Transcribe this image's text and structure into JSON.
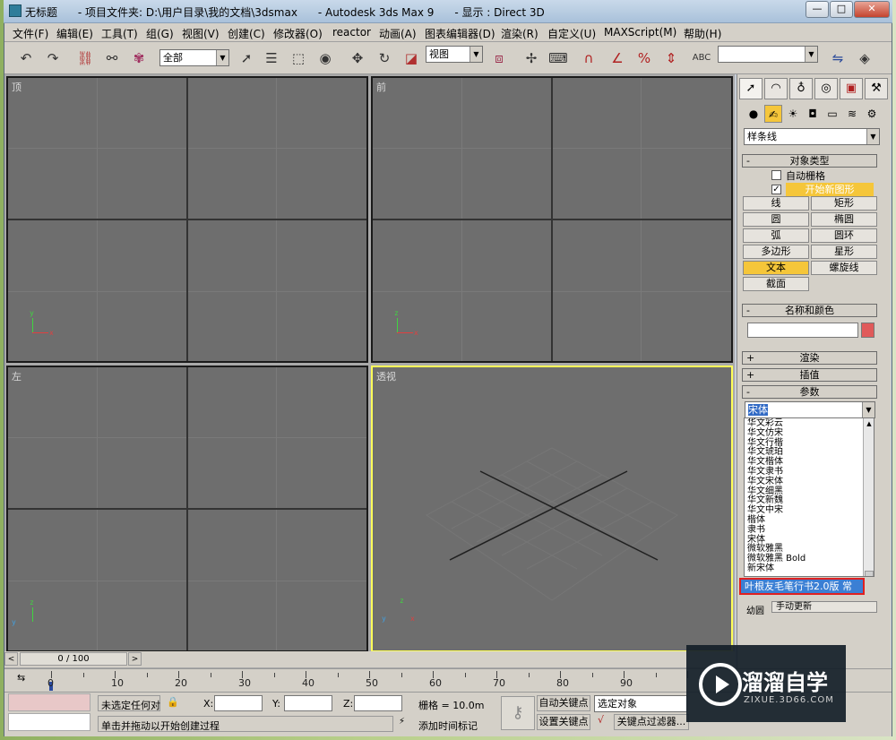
{
  "window": {
    "title": "无标题      - 项目文件夹: D:\\用户目录\\我的文档\\3dsmax      - Autodesk 3ds Max 9      - 显示 : Direct 3D",
    "controls": [
      "—",
      "□",
      "✕"
    ]
  },
  "menu": [
    "文件(F)",
    "编辑(E)",
    "工具(T)",
    "组(G)",
    "视图(V)",
    "创建(C)",
    "修改器(O)",
    "reactor",
    "动画(A)",
    "图表编辑器(D)",
    "渲染(R)",
    "自定义(U)",
    "MAXScript(M)",
    "帮助(H)"
  ],
  "toolbar": {
    "selection_filter": "全部",
    "ref_coord": "视图",
    "named_sel": ""
  },
  "viewports": [
    {
      "label": "顶"
    },
    {
      "label": "前"
    },
    {
      "label": "左"
    },
    {
      "label": "透视"
    }
  ],
  "axes": {
    "x": "x",
    "y": "y",
    "z": "z"
  },
  "command_panel": {
    "category": "样条线",
    "object_type": {
      "header": "对象类型",
      "auto_grid": "自动栅格",
      "start_new_shape": "开始新图形",
      "buttons": [
        {
          "label": "线"
        },
        {
          "label": "矩形"
        },
        {
          "label": "圆"
        },
        {
          "label": "椭圆"
        },
        {
          "label": "弧"
        },
        {
          "label": "圆环"
        },
        {
          "label": "多边形"
        },
        {
          "label": "星形"
        },
        {
          "label": "文本",
          "active": true
        },
        {
          "label": "螺旋线"
        },
        {
          "label": "截面"
        }
      ]
    },
    "name_color": {
      "header": "名称和颜色",
      "color": "#e05a5a"
    },
    "rollouts": [
      {
        "sign": "+",
        "label": "渲染"
      },
      {
        "sign": "+",
        "label": "插值"
      },
      {
        "sign": "-",
        "label": "参数"
      }
    ],
    "font_selected": "宋体",
    "font_list": [
      "华文彩云",
      "华文仿宋",
      "华文行楷",
      "华文琥珀",
      "华文楷体",
      "华文隶书",
      "华文宋体",
      "华文细黑",
      "华文新魏",
      "华文中宋",
      "楷体",
      "隶书",
      "宋体",
      "微软雅黑",
      "微软雅黑 Bold",
      "新宋体"
    ],
    "highlighted_font": "叶根友毛笔行书2.0版 常",
    "below_item": "幼圆",
    "manual_update": "手动更新"
  },
  "timeline": {
    "frame_counter": "0 / 100",
    "ticks": [
      "0",
      "10",
      "20",
      "30",
      "40",
      "50",
      "60",
      "70",
      "80",
      "90"
    ]
  },
  "status": {
    "selection": "未选定任何对",
    "x_label": "X:",
    "y_label": "Y:",
    "z_label": "Z:",
    "grid": "栅格 = 10.0m",
    "prompt": "单击并拖动以开始创建过程",
    "add_time_tag": "添加时间标记",
    "auto_key": "自动关键点",
    "set_key": "设置关键点",
    "selected_object": "选定对象",
    "key_filters": "关键点过滤器..."
  },
  "watermark": {
    "brand": "溜溜自学",
    "url": "ZIXUE.3D66.COM"
  }
}
